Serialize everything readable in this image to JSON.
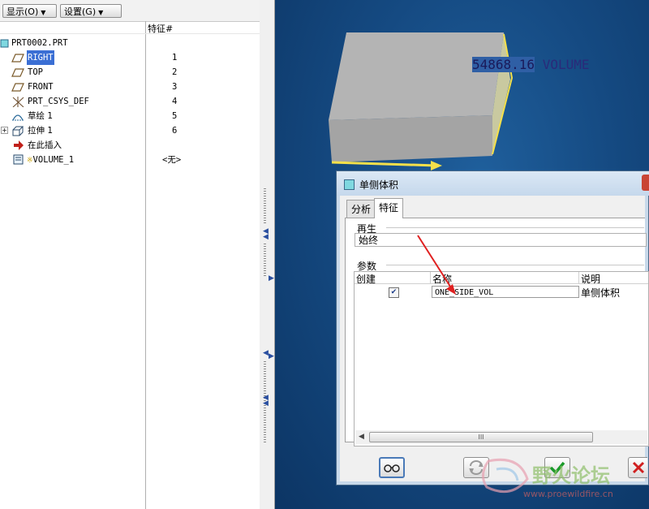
{
  "toolbar": {
    "show_label": "显示(O)",
    "settings_label": "设置(G)"
  },
  "tree": {
    "column_feature_header": "特征#",
    "root": "PRT0002.PRT",
    "items": [
      {
        "label": "RIGHT",
        "num": "1",
        "selected": true,
        "icon": "datum-plane-icon"
      },
      {
        "label": "TOP",
        "num": "2",
        "icon": "datum-plane-icon"
      },
      {
        "label": "FRONT",
        "num": "3",
        "icon": "datum-plane-icon"
      },
      {
        "label": "PRT_CSYS_DEF",
        "num": "4",
        "icon": "coordinate-system-icon"
      },
      {
        "label": "草绘 1",
        "num": "5",
        "icon": "sketch-icon"
      },
      {
        "label": "拉伸 1",
        "num": "6",
        "icon": "extrude-icon"
      },
      {
        "label": "在此插入",
        "num": "",
        "icon": "insert-here-arrow-icon"
      },
      {
        "label": "VOLUME_1",
        "num": "<无>",
        "icon": "analysis-feature-icon"
      }
    ]
  },
  "viewport": {
    "volume_value": "54868.16",
    "volume_unit": "VOLUME"
  },
  "dialog": {
    "title": "单侧体积",
    "tabs": [
      "分析",
      "特征"
    ],
    "active_tab": "特征",
    "regen_group": "再生",
    "regen_value": "始终",
    "params_group": "参数",
    "columns": [
      "创建",
      "名称",
      "说明"
    ],
    "param_row": {
      "checked": true,
      "name": "ONE_SIDE_VOL",
      "description": "单侧体积"
    },
    "scroll_marker": "III"
  },
  "watermark": {
    "text": "野火论坛",
    "url": "www.proewildfire.cn"
  },
  "colors": {
    "viewport_bg": "#154a82",
    "selection": "#3b6fd4",
    "annotation_arrow": "#e02020",
    "edge_highlight": "#f5e04a"
  }
}
